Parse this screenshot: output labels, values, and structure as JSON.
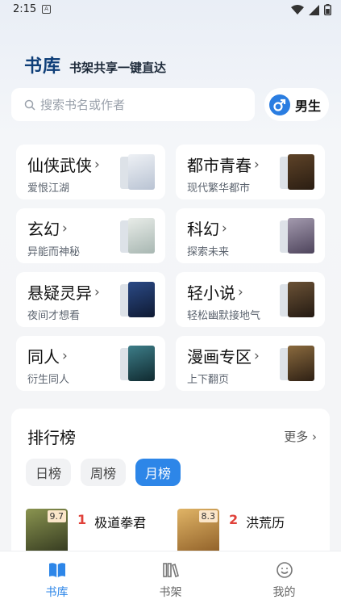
{
  "status_bar": {
    "time": "2:15",
    "notification_glyph": "A"
  },
  "header": {
    "title": "书库",
    "subtitle": "书架共享一键直达"
  },
  "search": {
    "placeholder": "搜索书名或作者"
  },
  "gender_toggle": {
    "label": "男生",
    "icon": "male-icon"
  },
  "categories": [
    {
      "name": "仙侠武侠",
      "desc": "爱恨江湖",
      "cover_color": "#cfd8e6"
    },
    {
      "name": "都市青春",
      "desc": "现代繁华都市",
      "cover_color": "#3a2a1c"
    },
    {
      "name": "玄幻",
      "desc": "异能而神秘",
      "cover_color": "#c9d2cf"
    },
    {
      "name": "科幻",
      "desc": "探索未来",
      "cover_color": "#7b6c86"
    },
    {
      "name": "悬疑灵异",
      "desc": "夜间才想看",
      "cover_color": "#1c2f55"
    },
    {
      "name": "轻小说",
      "desc": "轻松幽默接地气",
      "cover_color": "#3a2b22"
    },
    {
      "name": "同人",
      "desc": "衍生同人",
      "cover_color": "#1f4c56"
    },
    {
      "name": "漫画专区",
      "desc": "上下翻页",
      "cover_color": "#4a3320"
    }
  ],
  "ranking": {
    "title": "排行榜",
    "more": "更多",
    "tabs": [
      {
        "label": "日榜",
        "active": false
      },
      {
        "label": "周榜",
        "active": false
      },
      {
        "label": "月榜",
        "active": true
      }
    ],
    "books": [
      {
        "rank": "1",
        "name": "极道拳君",
        "score": "9.7",
        "cover_color": "#5a5f3a"
      },
      {
        "rank": "2",
        "name": "洪荒历",
        "score": "8.3",
        "cover_color": "#c08a3c"
      }
    ]
  },
  "tabbar": [
    {
      "label": "书库",
      "icon": "book-open-icon",
      "active": true
    },
    {
      "label": "书架",
      "icon": "bookshelf-icon",
      "active": false
    },
    {
      "label": "我的",
      "icon": "smiley-face-icon",
      "active": false
    }
  ],
  "colors": {
    "accent": "#2d86e8",
    "title_blue": "#0e3e78",
    "rank_red": "#e0413a"
  }
}
